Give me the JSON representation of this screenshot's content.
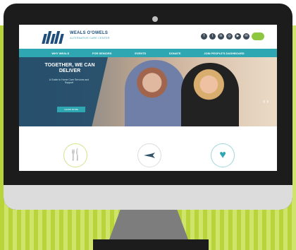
{
  "header": {
    "brand": "WEALS O'OWELS",
    "brand_sub": "ALTERNATIVE CARE CENTER"
  },
  "navigation": [
    "WHY WEALS",
    "FOR SENIORS",
    "EVENTS",
    "DONATE",
    "JOIN PEOPLE'S DASHBOARD"
  ],
  "hero": {
    "title": "TOGETHER, WE CAN DELIVER",
    "text": "A Guide to Home Care Services and Support",
    "button": "LEARN MORE"
  },
  "social_icons": [
    "facebook",
    "twitter",
    "linkedin",
    "instagram",
    "youtube",
    "mail"
  ],
  "colors": {
    "teal": "#2ea7b2",
    "navy": "#234e6b",
    "green": "#8dc63f"
  }
}
